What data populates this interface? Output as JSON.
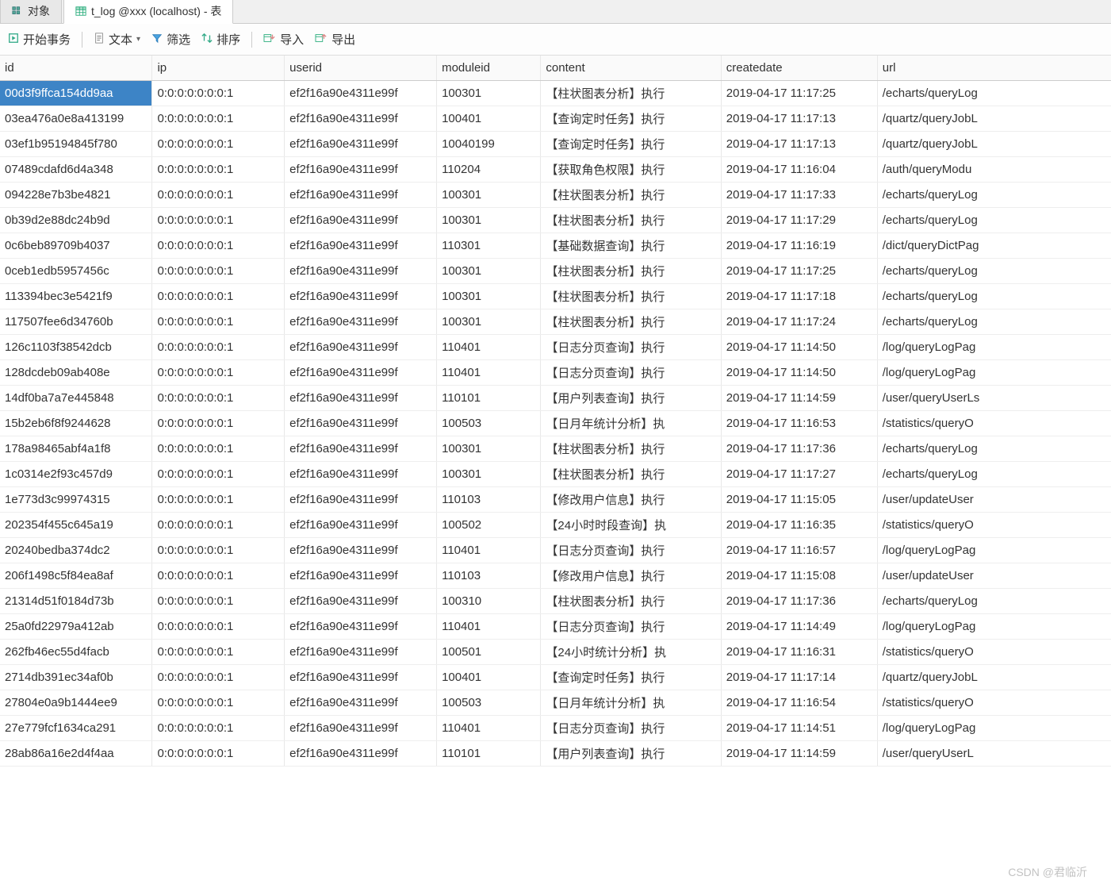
{
  "tabs": [
    {
      "label": "对象",
      "icon": "objects"
    },
    {
      "label": "t_log @xxx (localhost) - 表",
      "icon": "table",
      "active": true
    }
  ],
  "toolbar": {
    "begin_tx": "开始事务",
    "text": "文本",
    "filter": "筛选",
    "sort": "排序",
    "import": "导入",
    "export": "导出"
  },
  "columns": [
    "id",
    "ip",
    "userid",
    "moduleid",
    "content",
    "createdate",
    "url"
  ],
  "rows": [
    {
      "id": "00d3f9ffca154dd9aa",
      "ip": "0:0:0:0:0:0:0:1",
      "userid": "ef2f16a90e4311e99f",
      "moduleid": "100301",
      "content": "【柱状图表分析】执行",
      "createdate": "2019-04-17 11:17:25",
      "url": "/echarts/queryLog",
      "selected": true
    },
    {
      "id": "03ea476a0e8a413199",
      "ip": "0:0:0:0:0:0:0:1",
      "userid": "ef2f16a90e4311e99f",
      "moduleid": "100401",
      "content": "【查询定时任务】执行",
      "createdate": "2019-04-17 11:17:13",
      "url": "/quartz/queryJobL"
    },
    {
      "id": "03ef1b95194845f780",
      "ip": "0:0:0:0:0:0:0:1",
      "userid": "ef2f16a90e4311e99f",
      "moduleid": "10040199",
      "content": "【查询定时任务】执行",
      "createdate": "2019-04-17 11:17:13",
      "url": "/quartz/queryJobL"
    },
    {
      "id": "07489cdafd6d4a348",
      "ip": "0:0:0:0:0:0:0:1",
      "userid": "ef2f16a90e4311e99f",
      "moduleid": "110204",
      "content": "【获取角色权限】执行",
      "createdate": "2019-04-17 11:16:04",
      "url": "/auth/queryModu"
    },
    {
      "id": "094228e7b3be4821",
      "ip": "0:0:0:0:0:0:0:1",
      "userid": "ef2f16a90e4311e99f",
      "moduleid": "100301",
      "content": "【柱状图表分析】执行",
      "createdate": "2019-04-17 11:17:33",
      "url": "/echarts/queryLog"
    },
    {
      "id": "0b39d2e88dc24b9d",
      "ip": "0:0:0:0:0:0:0:1",
      "userid": "ef2f16a90e4311e99f",
      "moduleid": "100301",
      "content": "【柱状图表分析】执行",
      "createdate": "2019-04-17 11:17:29",
      "url": "/echarts/queryLog"
    },
    {
      "id": "0c6beb89709b4037",
      "ip": "0:0:0:0:0:0:0:1",
      "userid": "ef2f16a90e4311e99f",
      "moduleid": "110301",
      "content": "【基础数据查询】执行",
      "createdate": "2019-04-17 11:16:19",
      "url": "/dict/queryDictPag"
    },
    {
      "id": "0ceb1edb5957456c",
      "ip": "0:0:0:0:0:0:0:1",
      "userid": "ef2f16a90e4311e99f",
      "moduleid": "100301",
      "content": "【柱状图表分析】执行",
      "createdate": "2019-04-17 11:17:25",
      "url": "/echarts/queryLog"
    },
    {
      "id": "113394bec3e5421f9",
      "ip": "0:0:0:0:0:0:0:1",
      "userid": "ef2f16a90e4311e99f",
      "moduleid": "100301",
      "content": "【柱状图表分析】执行",
      "createdate": "2019-04-17 11:17:18",
      "url": "/echarts/queryLog"
    },
    {
      "id": "117507fee6d34760b",
      "ip": "0:0:0:0:0:0:0:1",
      "userid": "ef2f16a90e4311e99f",
      "moduleid": "100301",
      "content": "【柱状图表分析】执行",
      "createdate": "2019-04-17 11:17:24",
      "url": "/echarts/queryLog"
    },
    {
      "id": "126c1103f38542dcb",
      "ip": "0:0:0:0:0:0:0:1",
      "userid": "ef2f16a90e4311e99f",
      "moduleid": "110401",
      "content": "【日志分页查询】执行",
      "createdate": "2019-04-17 11:14:50",
      "url": "/log/queryLogPag"
    },
    {
      "id": "128dcdeb09ab408e",
      "ip": "0:0:0:0:0:0:0:1",
      "userid": "ef2f16a90e4311e99f",
      "moduleid": "110401",
      "content": "【日志分页查询】执行",
      "createdate": "2019-04-17 11:14:50",
      "url": "/log/queryLogPag"
    },
    {
      "id": "14df0ba7a7e445848",
      "ip": "0:0:0:0:0:0:0:1",
      "userid": "ef2f16a90e4311e99f",
      "moduleid": "110101",
      "content": "【用户列表查询】执行",
      "createdate": "2019-04-17 11:14:59",
      "url": "/user/queryUserLs"
    },
    {
      "id": "15b2eb6f8f9244628",
      "ip": "0:0:0:0:0:0:0:1",
      "userid": "ef2f16a90e4311e99f",
      "moduleid": "100503",
      "content": "【日月年统计分析】执",
      "createdate": "2019-04-17 11:16:53",
      "url": "/statistics/queryO"
    },
    {
      "id": "178a98465abf4a1f8",
      "ip": "0:0:0:0:0:0:0:1",
      "userid": "ef2f16a90e4311e99f",
      "moduleid": "100301",
      "content": "【柱状图表分析】执行",
      "createdate": "2019-04-17 11:17:36",
      "url": "/echarts/queryLog"
    },
    {
      "id": "1c0314e2f93c457d9",
      "ip": "0:0:0:0:0:0:0:1",
      "userid": "ef2f16a90e4311e99f",
      "moduleid": "100301",
      "content": "【柱状图表分析】执行",
      "createdate": "2019-04-17 11:17:27",
      "url": "/echarts/queryLog"
    },
    {
      "id": "1e773d3c99974315",
      "ip": "0:0:0:0:0:0:0:1",
      "userid": "ef2f16a90e4311e99f",
      "moduleid": "110103",
      "content": "【修改用户信息】执行",
      "createdate": "2019-04-17 11:15:05",
      "url": "/user/updateUser"
    },
    {
      "id": "202354f455c645a19",
      "ip": "0:0:0:0:0:0:0:1",
      "userid": "ef2f16a90e4311e99f",
      "moduleid": "100502",
      "content": "【24小时时段查询】执",
      "createdate": "2019-04-17 11:16:35",
      "url": "/statistics/queryO"
    },
    {
      "id": "20240bedba374dc2",
      "ip": "0:0:0:0:0:0:0:1",
      "userid": "ef2f16a90e4311e99f",
      "moduleid": "110401",
      "content": "【日志分页查询】执行",
      "createdate": "2019-04-17 11:16:57",
      "url": "/log/queryLogPag"
    },
    {
      "id": "206f1498c5f84ea8af",
      "ip": "0:0:0:0:0:0:0:1",
      "userid": "ef2f16a90e4311e99f",
      "moduleid": "110103",
      "content": "【修改用户信息】执行",
      "createdate": "2019-04-17 11:15:08",
      "url": "/user/updateUser"
    },
    {
      "id": "21314d51f0184d73b",
      "ip": "0:0:0:0:0:0:0:1",
      "userid": "ef2f16a90e4311e99f",
      "moduleid": "100310",
      "content": "【柱状图表分析】执行",
      "createdate": "2019-04-17 11:17:36",
      "url": "/echarts/queryLog"
    },
    {
      "id": "25a0fd22979a412ab",
      "ip": "0:0:0:0:0:0:0:1",
      "userid": "ef2f16a90e4311e99f",
      "moduleid": "110401",
      "content": "【日志分页查询】执行",
      "createdate": "2019-04-17 11:14:49",
      "url": "/log/queryLogPag"
    },
    {
      "id": "262fb46ec55d4facb",
      "ip": "0:0:0:0:0:0:0:1",
      "userid": "ef2f16a90e4311e99f",
      "moduleid": "100501",
      "content": "【24小时统计分析】执",
      "createdate": "2019-04-17 11:16:31",
      "url": "/statistics/queryO"
    },
    {
      "id": "2714db391ec34af0b",
      "ip": "0:0:0:0:0:0:0:1",
      "userid": "ef2f16a90e4311e99f",
      "moduleid": "100401",
      "content": "【查询定时任务】执行",
      "createdate": "2019-04-17 11:17:14",
      "url": "/quartz/queryJobL"
    },
    {
      "id": "27804e0a9b1444ee9",
      "ip": "0:0:0:0:0:0:0:1",
      "userid": "ef2f16a90e4311e99f",
      "moduleid": "100503",
      "content": "【日月年统计分析】执",
      "createdate": "2019-04-17 11:16:54",
      "url": "/statistics/queryO"
    },
    {
      "id": "27e779fcf1634ca291",
      "ip": "0:0:0:0:0:0:0:1",
      "userid": "ef2f16a90e4311e99f",
      "moduleid": "110401",
      "content": "【日志分页查询】执行",
      "createdate": "2019-04-17 11:14:51",
      "url": "/log/queryLogPag"
    },
    {
      "id": "28ab86a16e2d4f4aa",
      "ip": "0:0:0:0:0:0:0:1",
      "userid": "ef2f16a90e4311e99f",
      "moduleid": "110101",
      "content": "【用户列表查询】执行",
      "createdate": "2019-04-17 11:14:59",
      "url": "/user/queryUserL"
    }
  ],
  "watermark": "CSDN @君临沂"
}
